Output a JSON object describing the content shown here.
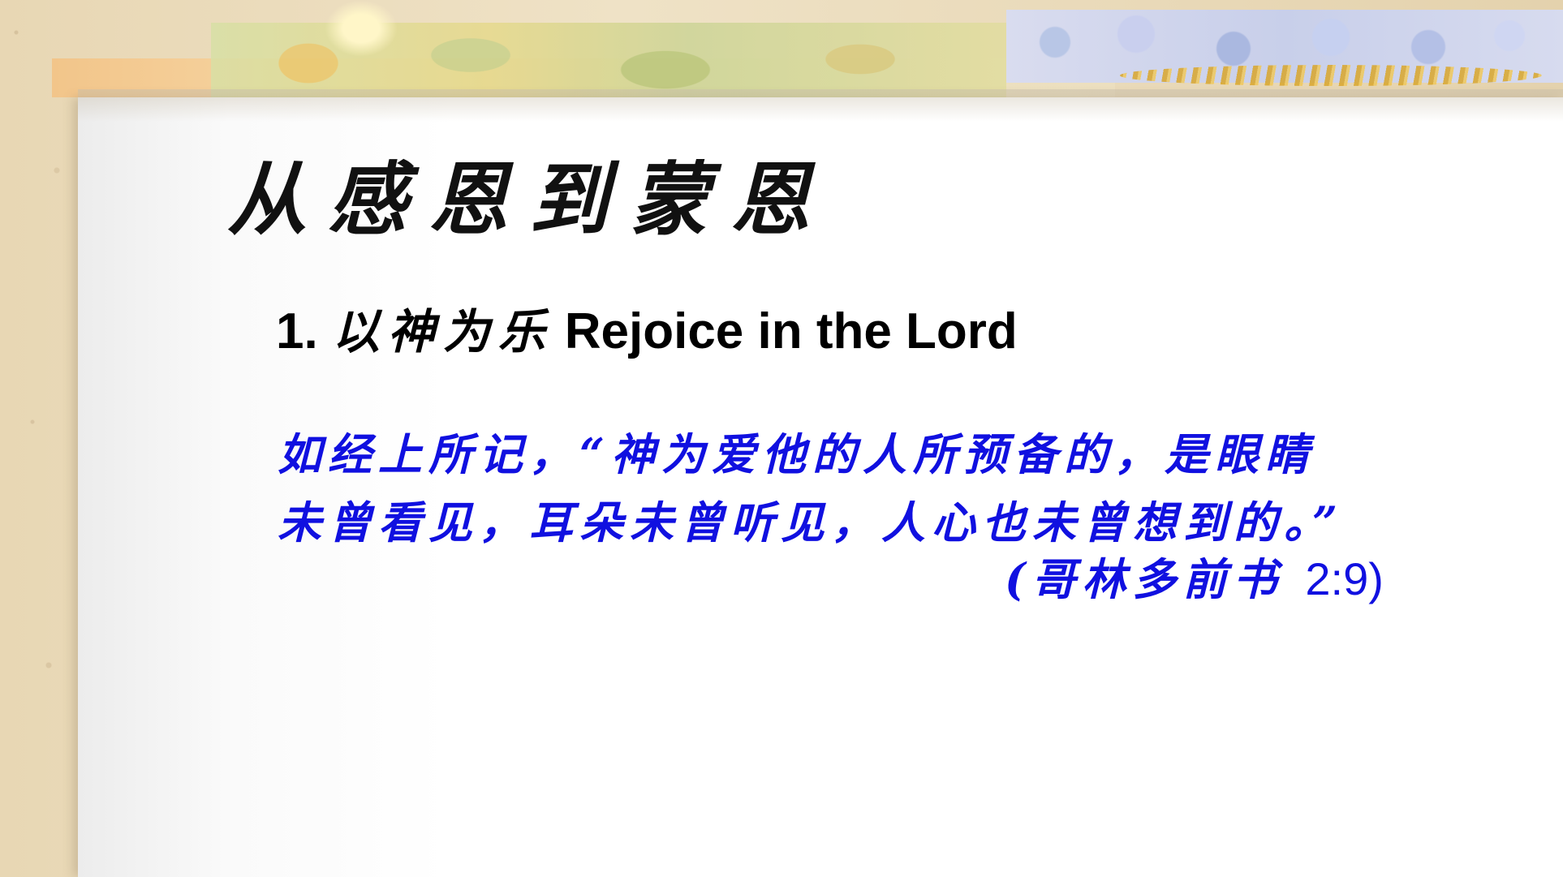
{
  "slide": {
    "title": "从感恩到蒙恩",
    "subtitle": {
      "number": "1.",
      "chinese": "以神为乐",
      "english": "Rejoice in the Lord"
    },
    "verse": {
      "line1": "如经上所记，“神为爱他的人所预备的，是眼睛",
      "line2": "未曾看见，耳朵未曾听见，人心也未曾想到的。”"
    },
    "reference": {
      "book": "(哥林多前书",
      "chapter_verse": "2:9)"
    }
  },
  "colors": {
    "title": "#111111",
    "verse": "#1010e0",
    "background": "#e9dcbf"
  }
}
